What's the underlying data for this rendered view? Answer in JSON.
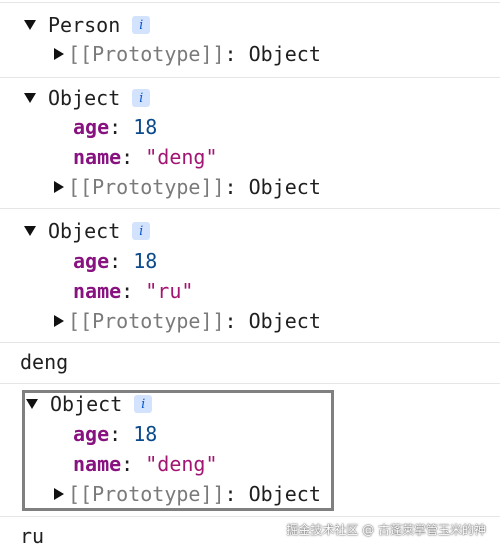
{
  "entries": [
    {
      "header": "Person",
      "info_badge": "i",
      "proto_label": "[[Prototype]]",
      "proto_value": "Object"
    },
    {
      "header": "Object",
      "info_badge": "i",
      "props": [
        {
          "key": "age",
          "value": "18",
          "type": "number"
        },
        {
          "key": "name",
          "value": "\"deng\"",
          "type": "string"
        }
      ],
      "proto_label": "[[Prototype]]",
      "proto_value": "Object"
    },
    {
      "header": "Object",
      "info_badge": "i",
      "props": [
        {
          "key": "age",
          "value": "18",
          "type": "number"
        },
        {
          "key": "name",
          "value": "\"ru\"",
          "type": "string"
        }
      ],
      "proto_label": "[[Prototype]]",
      "proto_value": "Object"
    },
    {
      "text": "deng"
    },
    {
      "header": "Object",
      "info_badge": "i",
      "props": [
        {
          "key": "age",
          "value": "18",
          "type": "number"
        },
        {
          "key": "name",
          "value": "\"deng\"",
          "type": "string"
        }
      ],
      "proto_label": "[[Prototype]]",
      "proto_value": "Object",
      "highlighted": true
    },
    {
      "text": "ru"
    }
  ],
  "watermark": "掘金技术社区 @ 古蓬莱掌管玉米的神",
  "colors": {
    "key": "#881280",
    "number": "#0b4a8b",
    "string": "#a31572",
    "prototype": "#7a7a7a",
    "info_badge_bg": "#d3e3fd",
    "info_badge_fg": "#0b57d0",
    "highlight_border": "#808080"
  }
}
